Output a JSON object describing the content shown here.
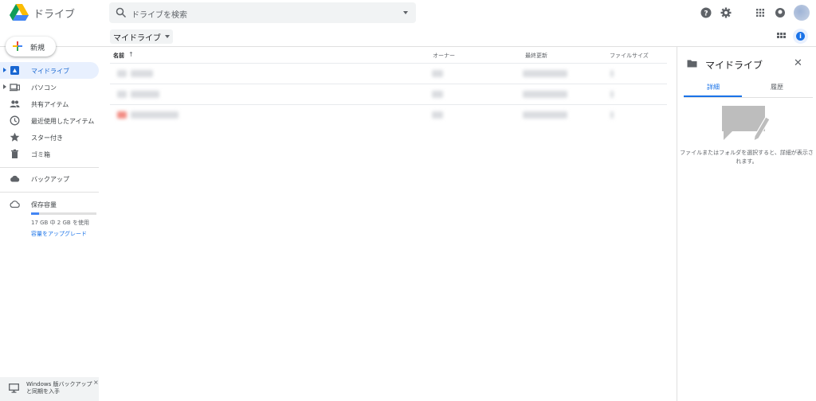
{
  "header": {
    "app_title": "ドライブ",
    "search_placeholder": "ドライブを検索",
    "icons": [
      "help-icon",
      "settings-icon",
      "apps-grid-icon",
      "notifications-icon",
      "account-avatar"
    ]
  },
  "sidebar": {
    "new_label": "新規",
    "items": [
      {
        "label": "マイドライブ",
        "icon": "my-drive-icon",
        "active": true
      },
      {
        "label": "パソコン",
        "icon": "computers-icon",
        "active": false
      },
      {
        "label": "共有アイテム",
        "icon": "shared-icon",
        "active": false
      },
      {
        "label": "最近使用したアイテム",
        "icon": "recent-icon",
        "active": false
      },
      {
        "label": "スター付き",
        "icon": "star-icon",
        "active": false
      },
      {
        "label": "ゴミ箱",
        "icon": "trash-icon",
        "active": false
      },
      {
        "label": "バックアップ",
        "icon": "backup-cloud-icon",
        "active": false
      },
      {
        "label": "保存容量",
        "icon": "storage-cloud-icon",
        "active": false
      }
    ],
    "storage": {
      "used_text": "17 GB 中 2 GB を使用",
      "upgrade_link": "容量をアップグレード",
      "used_fraction": 0.12
    },
    "promo": {
      "text": "Windows 版バックアップと同期を入手",
      "close": "×"
    }
  },
  "main": {
    "breadcrumb": "マイドライブ",
    "columns": {
      "name": "名前",
      "owner": "オーナー",
      "modified": "最終更新",
      "size": "ファイルサイズ"
    },
    "sort_indicator": "↑"
  },
  "details_panel": {
    "title": "マイドライブ",
    "close": "✕",
    "tabs": [
      {
        "label": "詳細",
        "active": true
      },
      {
        "label": "履歴",
        "active": false
      }
    ],
    "empty_message": "ファイルまたはフォルダを選択すると、詳細が表示されます。"
  },
  "colors": {
    "accent": "#1a73e8",
    "active_bg": "#e8f0fe",
    "text_muted": "#5f6368"
  }
}
